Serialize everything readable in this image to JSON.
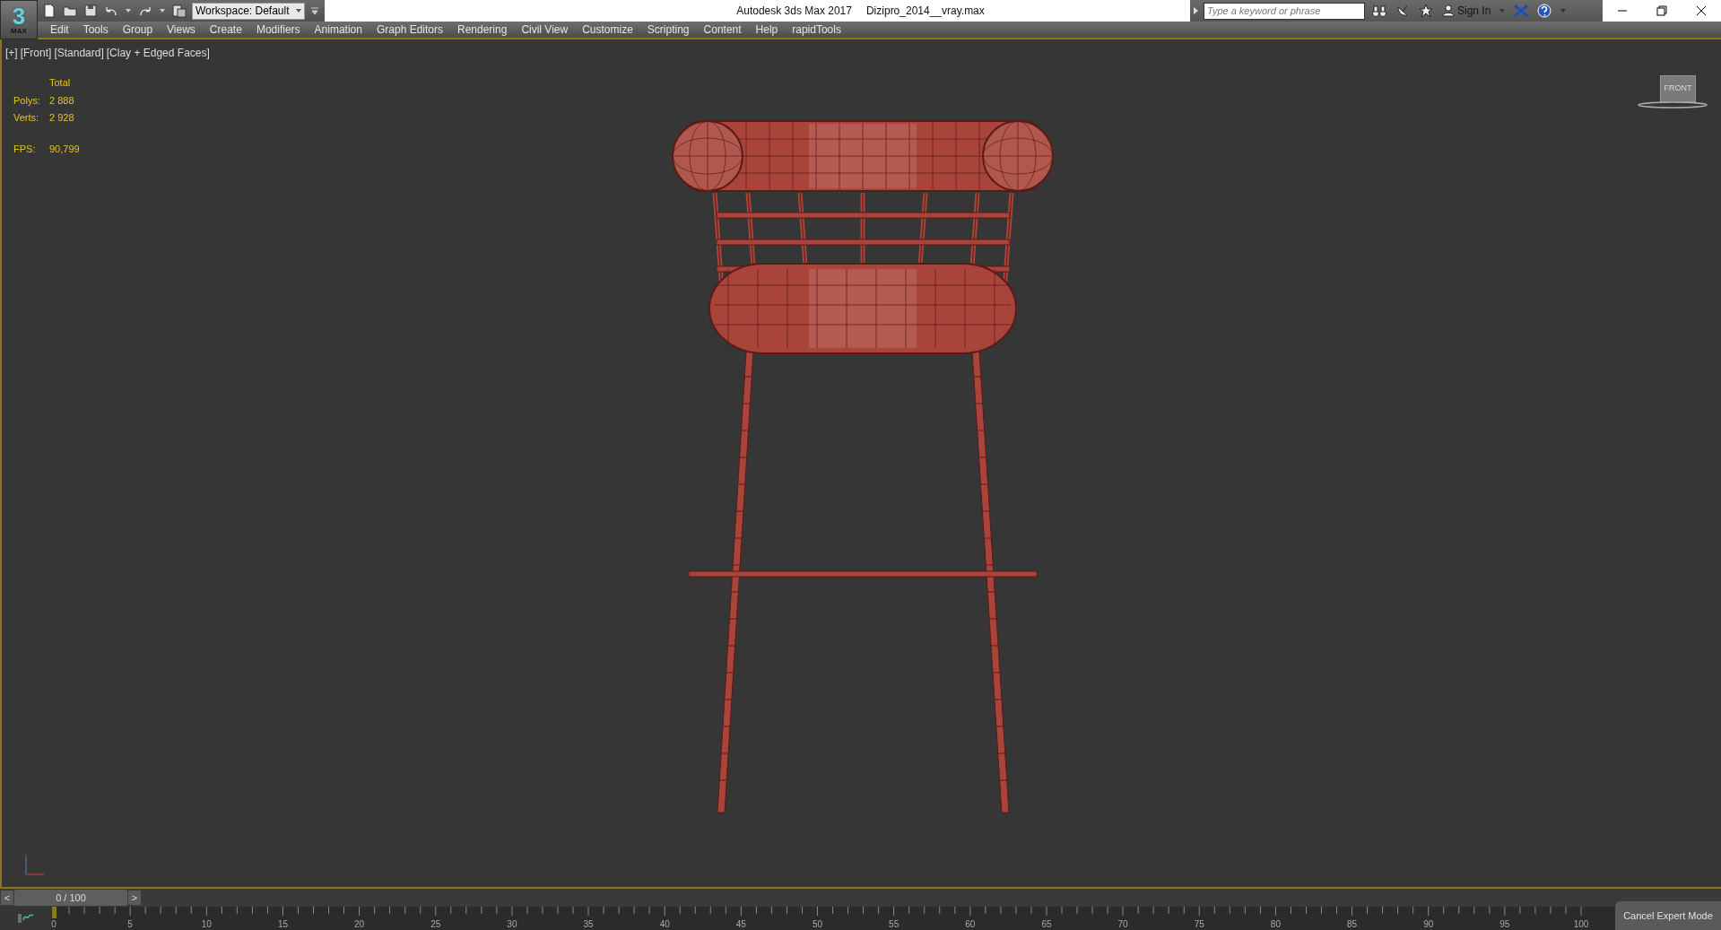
{
  "app_logo": {
    "digit": "3",
    "label": "MAX"
  },
  "quick_access": {
    "workspace": "Workspace: Default"
  },
  "window": {
    "title": "Autodesk 3ds Max 2017",
    "file": "Dizipro_2014__vray.max"
  },
  "infocenter": {
    "placeholder": "Type a keyword or phrase",
    "sign_in": "Sign In"
  },
  "menu": [
    "Edit",
    "Tools",
    "Group",
    "Views",
    "Create",
    "Modifiers",
    "Animation",
    "Graph Editors",
    "Rendering",
    "Civil View",
    "Customize",
    "Scripting",
    "Content",
    "Help",
    "rapidTools"
  ],
  "viewport": {
    "labels": [
      "[+]",
      "[Front]",
      "[Standard]",
      "[Clay + Edged Faces]"
    ],
    "stats": {
      "heading": "Total",
      "rows": [
        {
          "label": "Polys:",
          "value": "2 888"
        },
        {
          "label": "Verts:",
          "value": "2 928"
        },
        {
          "label": "FPS:",
          "value": "90,799"
        }
      ]
    },
    "viewcube": "FRONT"
  },
  "timeline": {
    "prev": "<",
    "next": ">",
    "frame": "0 / 100",
    "level": 0,
    "ticks": [
      "0",
      "5",
      "10",
      "15",
      "20",
      "25",
      "30",
      "35",
      "40",
      "45",
      "50",
      "55",
      "60",
      "65",
      "70",
      "75",
      "80",
      "85",
      "90",
      "95",
      "100"
    ]
  },
  "expert_mode_button": "Cancel Expert Mode"
}
